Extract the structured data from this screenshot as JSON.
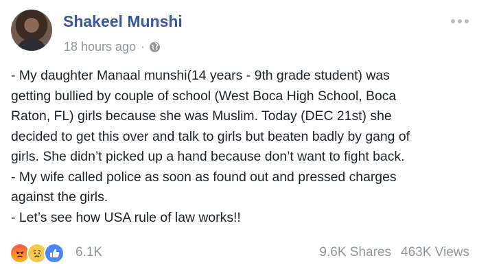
{
  "post": {
    "author": "Shakeel Munshi",
    "timestamp": "18 hours ago",
    "separator": "·",
    "privacy_icon": "globe-icon",
    "lines": [
      "- My daughter Manaal munshi(14 years - 9th grade student) was",
      "getting bullied by couple of school (West Boca High School, Boca",
      "Raton, FL) girls because she was Muslim. Today (DEC 21st) she",
      "decided to get this over and talk to girls but beaten badly by gang of",
      "girls. She didn’t picked up a hand because don’t want to fight back.",
      "- My wife called police as soon as found out and pressed charges",
      "against the girls.",
      "- Let’s see how USA rule of law works!!"
    ]
  },
  "reactions": {
    "icons": [
      "angry-reaction-icon",
      "sad-reaction-icon",
      "like-reaction-icon"
    ],
    "count": "6.1K"
  },
  "stats": {
    "shares": "9.6K Shares",
    "views": "463K Views"
  },
  "colors": {
    "author_link": "#365899",
    "muted_text": "#90949c",
    "like_blue": "#4e85f5"
  }
}
